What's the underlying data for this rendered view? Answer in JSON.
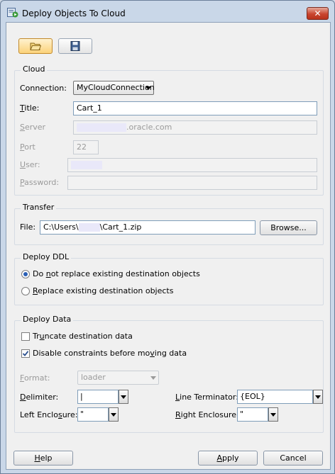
{
  "window": {
    "title": "Deploy Objects To Cloud",
    "close_label": "✕"
  },
  "cloud": {
    "legend": "Cloud",
    "connection_label": "Connection:",
    "connection_value": "MyCloudConnection",
    "title_label_u": "T",
    "title_label_rest": "itle:",
    "title_value": "Cart_1",
    "server_label_u": "S",
    "server_label_rest": "erver",
    "server_value": ".oracle.com",
    "port_label_u": "P",
    "port_label_rest": "ort",
    "port_value": "22",
    "user_label_u": "U",
    "user_label_rest": "ser:",
    "password_label_u": "P",
    "password_label_rest": "assword:"
  },
  "transfer": {
    "legend": "Transfer",
    "file_label": "File:",
    "file_prefix": "C:\\Users\\",
    "file_suffix": "\\Cart_1.zip",
    "browse_label": "Browse..."
  },
  "deploy_ddl": {
    "legend": "Deploy DDL",
    "option1_pre": "Do ",
    "option1_u": "n",
    "option1_post": "ot replace existing destination objects",
    "option1_selected": true,
    "option2_u": "R",
    "option2_post": "eplace existing destination objects",
    "option2_selected": false
  },
  "deploy_data": {
    "legend": "Deploy Data",
    "truncate_pre": "Tr",
    "truncate_u": "u",
    "truncate_post": "ncate destination data",
    "truncate_checked": false,
    "disable_pre": "Disable constraints before mo",
    "disable_u": "v",
    "disable_post": "ing data",
    "disable_checked": true,
    "format_label_u": "F",
    "format_label_rest": "ormat:",
    "format_value": "loader",
    "delimiter_label_u": "D",
    "delimiter_label_rest": "elimiter:",
    "delimiter_value": "|",
    "line_terminator_label_u": "L",
    "line_terminator_label_rest": "ine Terminator:",
    "line_terminator_value": "{EOL}",
    "left_enclosure_pre": "Left Enclo",
    "left_enclosure_u": "s",
    "left_enclosure_post": "ure:",
    "left_enclosure_value": "\"",
    "right_enclosure_u": "R",
    "right_enclosure_rest": "ight Enclosure:",
    "right_enclosure_value": "\""
  },
  "footer": {
    "help_u": "H",
    "help_rest": "elp",
    "apply_u": "A",
    "apply_rest": "pply",
    "cancel_label": "Cancel"
  }
}
